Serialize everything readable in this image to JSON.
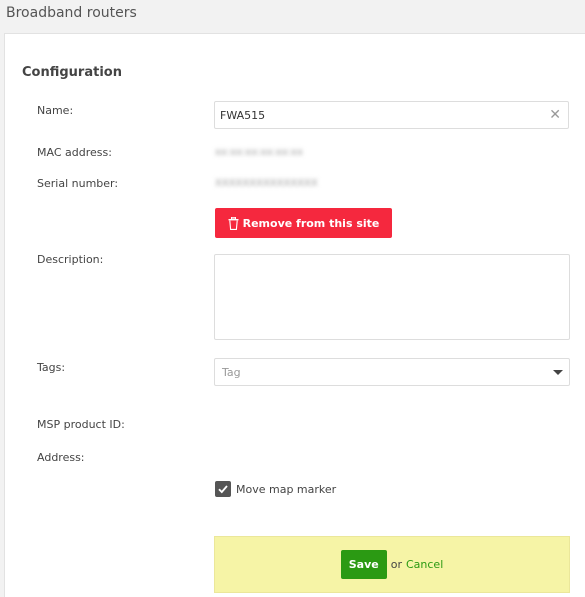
{
  "page": {
    "title": "Broadband routers"
  },
  "config": {
    "section_title": "Configuration",
    "labels": {
      "name": "Name:",
      "mac": "MAC address:",
      "serial": "Serial number:",
      "description": "Description:",
      "tags": "Tags:",
      "msp_product_id": "MSP product ID:",
      "address": "Address:"
    },
    "name_value": "FWA515",
    "clear_icon": "✕",
    "mac_value": "xx:xx:xx:xx:xx:xx",
    "serial_value": "XXXXXXXXXXXXXXX",
    "remove_button": "Remove from this site",
    "tag_placeholder": "Tag",
    "move_marker_label": "Move map marker",
    "move_marker_checked": true
  },
  "actions": {
    "save": "Save",
    "or": "or",
    "cancel": "Cancel"
  },
  "colors": {
    "remove": "#f5283e",
    "save": "#2b9a13",
    "save_bar": "#f6f4a6"
  }
}
